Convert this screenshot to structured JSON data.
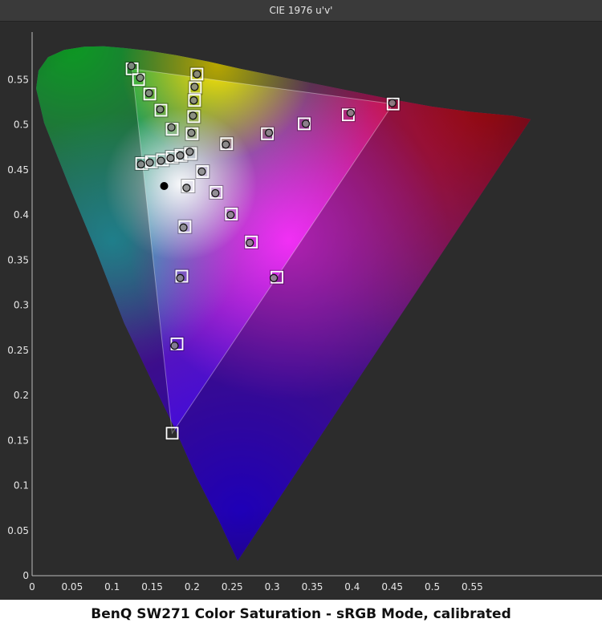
{
  "chart_data": {
    "type": "scatter",
    "title": "CIE 1976 u'v'",
    "xlim": [
      0,
      0.6
    ],
    "ylim": [
      0,
      0.6
    ],
    "x_ticks": [
      "0",
      "0.05",
      "0.1",
      "0.15",
      "0.2",
      "0.25",
      "0.3",
      "0.35",
      "0.4",
      "0.45",
      "0.5",
      "0.55"
    ],
    "y_ticks": [
      "0",
      "0.05",
      "0.1",
      "0.15",
      "0.2",
      "0.25",
      "0.3",
      "0.35",
      "0.4",
      "0.45",
      "0.5",
      "0.55"
    ],
    "gamut": {
      "red": [
        0.451,
        0.523
      ],
      "green": [
        0.125,
        0.562
      ],
      "blue": [
        0.175,
        0.158
      ],
      "white": [
        0.198,
        0.468
      ]
    },
    "white_point_measured": [
      0.165,
      0.432
    ],
    "series": [
      {
        "marker": "square",
        "points": [
          [
            0.125,
            0.562
          ],
          [
            0.133,
            0.55
          ],
          [
            0.147,
            0.534
          ],
          [
            0.161,
            0.516
          ],
          [
            0.175,
            0.495
          ],
          [
            0.137,
            0.457
          ],
          [
            0.149,
            0.459
          ],
          [
            0.163,
            0.461
          ],
          [
            0.175,
            0.464
          ],
          [
            0.186,
            0.466
          ],
          [
            0.198,
            0.468
          ],
          [
            0.206,
            0.556
          ],
          [
            0.204,
            0.541
          ],
          [
            0.203,
            0.527
          ],
          [
            0.202,
            0.509
          ],
          [
            0.2,
            0.49
          ],
          [
            0.243,
            0.479
          ],
          [
            0.294,
            0.49
          ],
          [
            0.34,
            0.501
          ],
          [
            0.395,
            0.511
          ],
          [
            0.451,
            0.523
          ],
          [
            0.195,
            0.432
          ],
          [
            0.191,
            0.387
          ],
          [
            0.187,
            0.332
          ],
          [
            0.181,
            0.257
          ],
          [
            0.175,
            0.158
          ],
          [
            0.213,
            0.448
          ],
          [
            0.23,
            0.425
          ],
          [
            0.249,
            0.401
          ],
          [
            0.274,
            0.37
          ],
          [
            0.306,
            0.331
          ]
        ]
      },
      {
        "marker": "circle",
        "points": [
          [
            0.124,
            0.565
          ],
          [
            0.135,
            0.552
          ],
          [
            0.146,
            0.535
          ],
          [
            0.16,
            0.517
          ],
          [
            0.174,
            0.497
          ],
          [
            0.136,
            0.456
          ],
          [
            0.147,
            0.458
          ],
          [
            0.161,
            0.46
          ],
          [
            0.173,
            0.463
          ],
          [
            0.185,
            0.466
          ],
          [
            0.197,
            0.47
          ],
          [
            0.206,
            0.556
          ],
          [
            0.203,
            0.542
          ],
          [
            0.202,
            0.527
          ],
          [
            0.201,
            0.51
          ],
          [
            0.199,
            0.491
          ],
          [
            0.242,
            0.478
          ],
          [
            0.296,
            0.491
          ],
          [
            0.342,
            0.501
          ],
          [
            0.398,
            0.513
          ],
          [
            0.45,
            0.524
          ],
          [
            0.193,
            0.43
          ],
          [
            0.189,
            0.386
          ],
          [
            0.185,
            0.33
          ],
          [
            0.178,
            0.255
          ],
          [
            0.212,
            0.448
          ],
          [
            0.229,
            0.424
          ],
          [
            0.248,
            0.4
          ],
          [
            0.272,
            0.369
          ],
          [
            0.302,
            0.33
          ]
        ]
      }
    ]
  },
  "caption": "BenQ SW271 Color Saturation - sRGB Mode, calibrated"
}
